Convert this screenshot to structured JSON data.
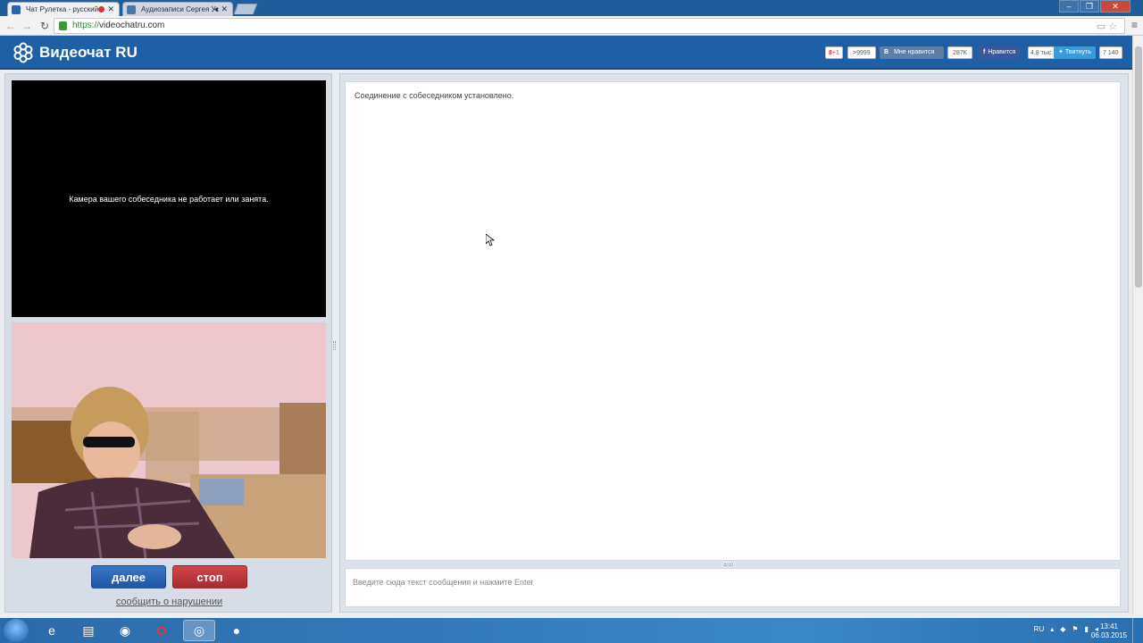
{
  "browser": {
    "tabs": [
      {
        "label": "Чат Рулетка - русский с",
        "active": true
      },
      {
        "label": "Аудиозаписи Сергея Ус",
        "active": false
      }
    ],
    "url_scheme": "https://",
    "url_host": "videochatru.com"
  },
  "site": {
    "brand": "Видеочат RU",
    "social": {
      "gplus_label": "+1",
      "gplus_count": ">9999",
      "vk_label": "Мне нравится",
      "vk_count": "287K",
      "fb_label": "Нравится",
      "fb_count": "4,8 тыс.",
      "tw_label": "Твитнуть",
      "tw_count": "7 140"
    }
  },
  "video": {
    "remote_message": "Камера вашего собеседника не работает или занята."
  },
  "controls": {
    "next_label": "далее",
    "stop_label": "стоп",
    "report_label": "сообщить о нарушении"
  },
  "chat": {
    "system_message": "Соединение с собеседником установлено.",
    "input_placeholder": "Введите сюда текст сообщения и нажмите Enter"
  },
  "taskbar": {
    "language": "RU",
    "time": "13:41",
    "date": "06.03.2015"
  },
  "colors": {
    "header_blue": "#1f5fa6",
    "next_button": "#2a62b5",
    "stop_button": "#bd3a40"
  }
}
